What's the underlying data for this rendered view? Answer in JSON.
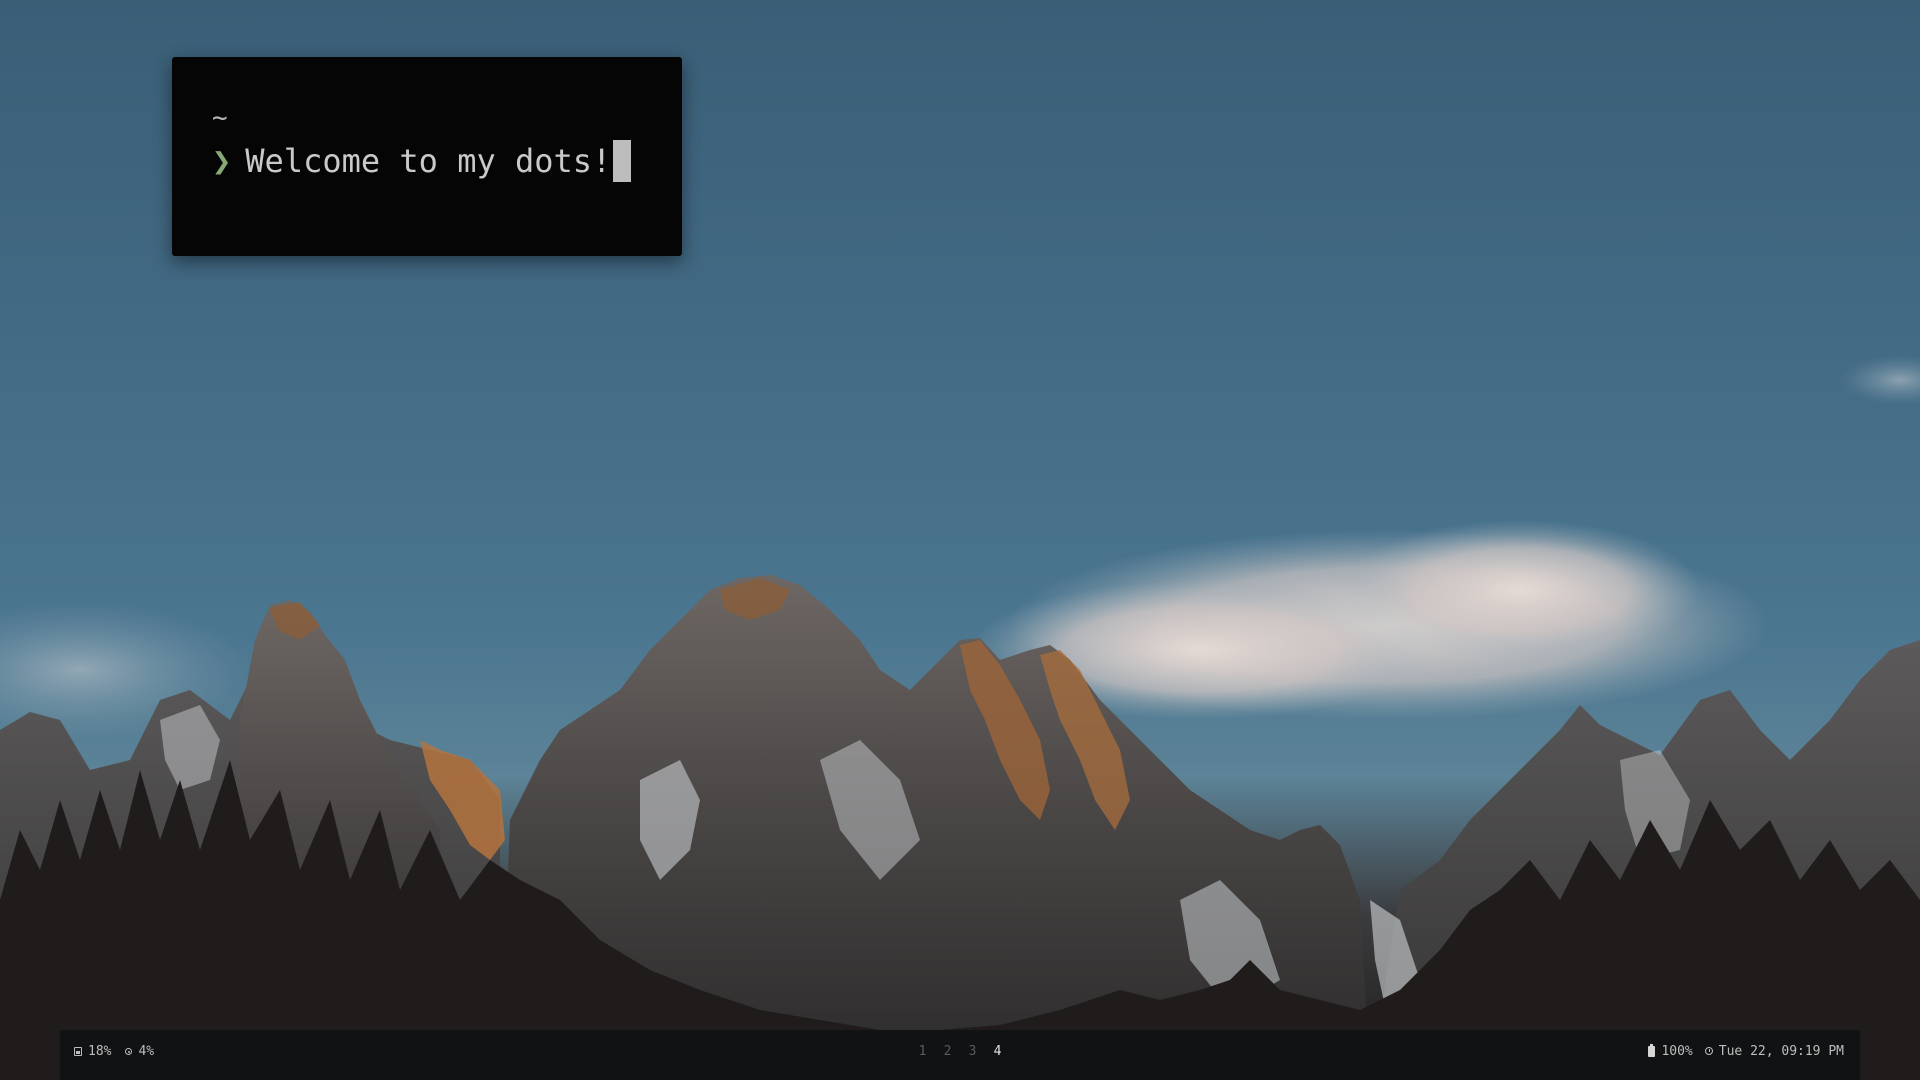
{
  "terminal": {
    "cwd": "~",
    "prompt_symbol": "❯",
    "command_text": "Welcome to my dots!"
  },
  "bar": {
    "left": {
      "disk": {
        "icon": "disk-icon",
        "value": "18%"
      },
      "cpu": {
        "icon": "cpu-icon",
        "value": "4%"
      }
    },
    "workspaces": [
      {
        "label": "1",
        "active": false
      },
      {
        "label": "2",
        "active": false
      },
      {
        "label": "3",
        "active": false
      },
      {
        "label": "4",
        "active": true
      }
    ],
    "right": {
      "battery": {
        "icon": "battery-icon",
        "value": "100%"
      },
      "clock": {
        "icon": "clock-icon",
        "value": "Tue 22, 09:19 PM"
      }
    }
  },
  "colors": {
    "sky": "#426a84",
    "terminal_bg": "#050505",
    "prompt": "#86a877",
    "bar_bg": "#111213",
    "workspace_active": "#e2e2e2",
    "workspace_inactive": "#5a5a5a"
  }
}
